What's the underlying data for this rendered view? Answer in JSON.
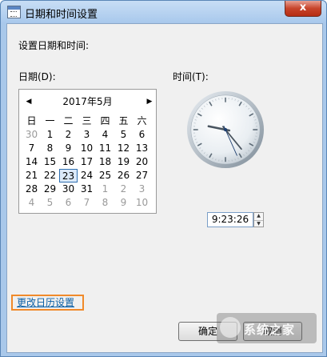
{
  "window": {
    "title": "日期和时间设置",
    "close_glyph": "x"
  },
  "heading": "设置日期和时间:",
  "date_label": "日期(D):",
  "time_label": "时间(T):",
  "calendar": {
    "month_title": "2017年5月",
    "prev_glyph": "◀",
    "next_glyph": "▶",
    "weekdays": [
      "日",
      "一",
      "二",
      "三",
      "四",
      "五",
      "六"
    ],
    "weeks": [
      [
        "30",
        "1",
        "2",
        "3",
        "4",
        "5",
        "6"
      ],
      [
        "7",
        "8",
        "9",
        "10",
        "11",
        "12",
        "13"
      ],
      [
        "14",
        "15",
        "16",
        "17",
        "18",
        "19",
        "20"
      ],
      [
        "21",
        "22",
        "23",
        "24",
        "25",
        "26",
        "27"
      ],
      [
        "28",
        "29",
        "30",
        "31",
        "1",
        "2",
        "3"
      ],
      [
        "4",
        "5",
        "6",
        "7",
        "8",
        "9",
        "10"
      ]
    ],
    "selected_day": "23"
  },
  "clock": {
    "hour": 9,
    "minute": 23,
    "second": 26
  },
  "time_value": "9:23:26",
  "spin_up_glyph": "▲",
  "spin_down_glyph": "▼",
  "change_calendar_link": "更改日历设置",
  "buttons": {
    "ok": "确定",
    "cancel": "取消"
  },
  "watermark_text": "系统之家"
}
